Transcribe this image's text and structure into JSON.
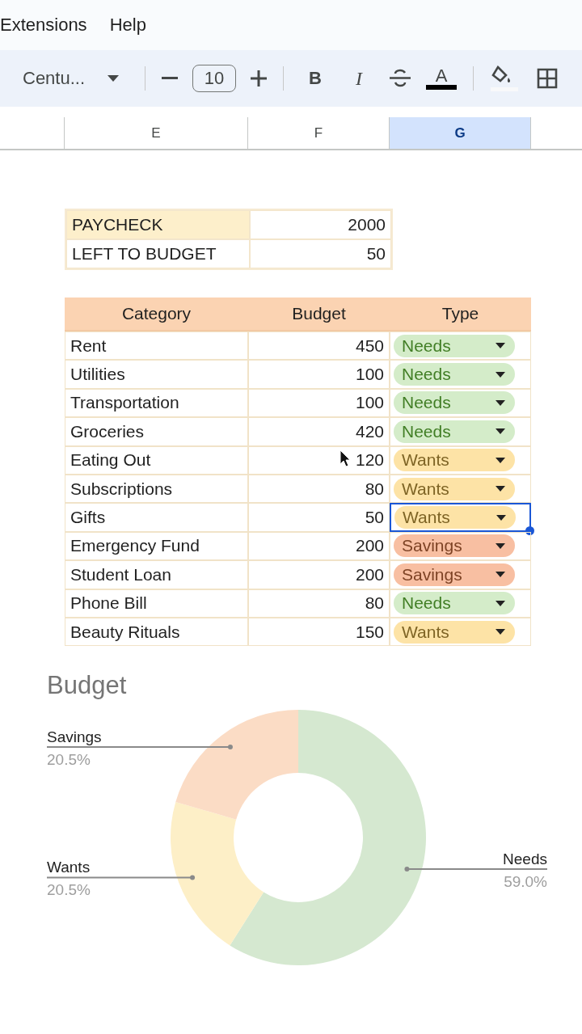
{
  "menu": [
    {
      "label": "Extensions"
    },
    {
      "label": "Help"
    }
  ],
  "toolbar": {
    "font": "Centu...",
    "font_size": "10",
    "bold": "B",
    "italic": "I",
    "text_color": "A"
  },
  "column_headers": [
    {
      "label": "E",
      "selected": false
    },
    {
      "label": "F",
      "selected": false
    },
    {
      "label": "G",
      "selected": true
    }
  ],
  "summary": [
    {
      "label": "PAYCHECK",
      "value": "2000",
      "highlighted": true
    },
    {
      "label": "LEFT TO BUDGET",
      "value": "50",
      "highlighted": false
    }
  ],
  "budget_table": {
    "columns": [
      "Category",
      "Budget",
      "Type"
    ],
    "rows": [
      {
        "category": "Rent",
        "budget": "450",
        "type": {
          "label": "Needs",
          "color": "#d4ecc9"
        },
        "selected": false
      },
      {
        "category": "Utilities",
        "budget": "100",
        "type": {
          "label": "Needs",
          "color": "#d4ecc9"
        },
        "selected": false
      },
      {
        "category": "Transportation",
        "budget": "100",
        "type": {
          "label": "Needs",
          "color": "#d4ecc9"
        },
        "selected": false
      },
      {
        "category": "Groceries",
        "budget": "420",
        "type": {
          "label": "Needs",
          "color": "#d4ecc9"
        },
        "selected": false
      },
      {
        "category": "Eating Out",
        "budget": "120",
        "type": {
          "label": "Wants",
          "color": "#fde3a6"
        },
        "selected": false
      },
      {
        "category": "Subscriptions",
        "budget": "80",
        "type": {
          "label": "Wants",
          "color": "#fde3a6"
        },
        "selected": false
      },
      {
        "category": "Gifts",
        "budget": "50",
        "type": {
          "label": "Wants",
          "color": "#fde3a6"
        },
        "selected": true
      },
      {
        "category": "Emergency Fund",
        "budget": "200",
        "type": {
          "label": "Savings",
          "color": "#f8bfa2"
        },
        "selected": false
      },
      {
        "category": "Student Loan",
        "budget": "200",
        "type": {
          "label": "Savings",
          "color": "#f8bfa2"
        },
        "selected": false
      },
      {
        "category": "Phone Bill",
        "budget": "80",
        "type": {
          "label": "Needs",
          "color": "#d4ecc9"
        },
        "selected": false
      },
      {
        "category": "Beauty Rituals",
        "budget": "150",
        "type": {
          "label": "Wants",
          "color": "#fde3a6"
        },
        "selected": false
      }
    ]
  },
  "chart": {
    "chart_data": {
      "type": "donut",
      "title": "Budget",
      "categories": [
        "Needs",
        "Wants",
        "Savings"
      ],
      "values": [
        59.0,
        20.5,
        20.5
      ],
      "colors": [
        "#d5e8d0",
        "#fdefc7",
        "#fbdcc5"
      ],
      "value_labels": [
        "59.0%",
        "20.5%",
        "20.5%"
      ]
    }
  }
}
